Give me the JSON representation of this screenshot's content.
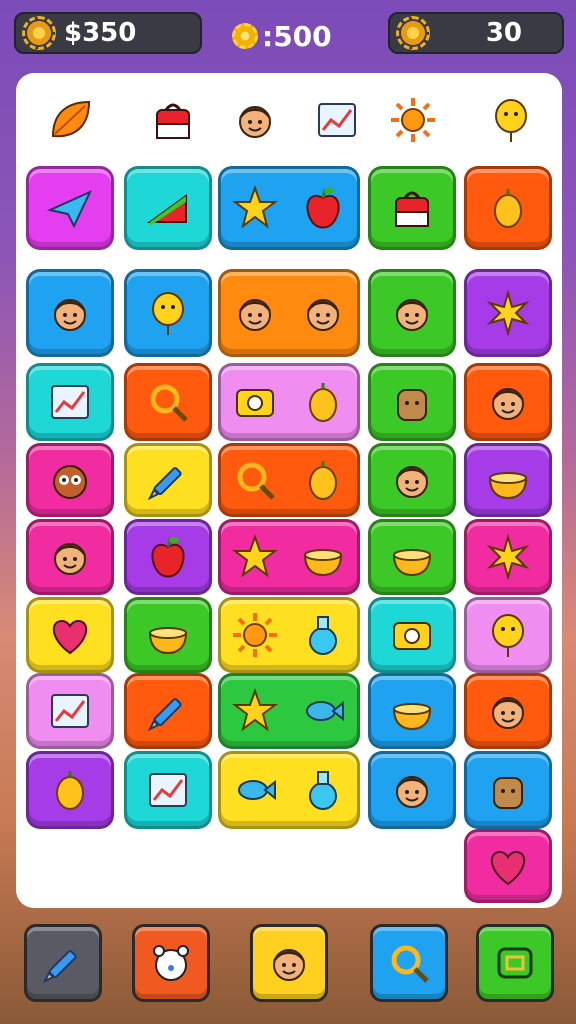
{
  "hud": {
    "money": "$350",
    "score": ":500",
    "timer": "30"
  },
  "header_icons": [
    "leaf-icon",
    "shopping-bag-icon",
    "character-face-icon",
    "picture-frame-icon",
    "sun-icon",
    "balloon-icon"
  ],
  "tiles": [
    {
      "icons": [
        "paper-plane-icon"
      ],
      "color": "#e53ef0"
    },
    {
      "icons": [
        "red-wedge-icon"
      ],
      "color": "#1ed8d8"
    },
    {
      "icons": [
        "star-icon",
        "apple-icon"
      ],
      "color": "#1fa2ef"
    },
    {
      "icons": [
        "backpack-icon"
      ],
      "color": "#3cc826"
    },
    {
      "icons": [
        "lemon-icon"
      ],
      "color": "#ff5a0d"
    },
    {
      "icons": [
        "elf-character-icon"
      ],
      "color": "#1fa2ef"
    },
    {
      "icons": [
        "balloon-icon"
      ],
      "color": "#1fa2ef"
    },
    {
      "icons": [
        "boy-face-icon",
        "girl-face-icon"
      ],
      "color": "#ff8a10"
    },
    {
      "icons": [
        "woman-face-icon"
      ],
      "color": "#3cc826"
    },
    {
      "icons": [
        "sparkle-stars-icon"
      ],
      "color": "#a63ce8"
    },
    {
      "icons": [
        "chart-icon"
      ],
      "color": "#1ed8d8"
    },
    {
      "icons": [
        "gem-icon"
      ],
      "color": "#ff5a0d"
    },
    {
      "icons": [
        "camera-icon",
        "mango-icon"
      ],
      "color": "#ef8ef0"
    },
    {
      "icons": [
        "toast-character-icon"
      ],
      "color": "#3cc826"
    },
    {
      "icons": [
        "smiling-man-icon"
      ],
      "color": "#ff5a0d"
    },
    {
      "icons": [
        "owl-icon"
      ],
      "color": "#f02ca0"
    },
    {
      "icons": [
        "pencil-icon"
      ],
      "color": "#ffe020"
    },
    {
      "icons": [
        "ring-icon",
        "lemon-icon"
      ],
      "color": "#ff5a0d"
    },
    {
      "icons": [
        "boy-face-icon"
      ],
      "color": "#3cc826"
    },
    {
      "icons": [
        "bowl-icon"
      ],
      "color": "#a63ce8"
    },
    {
      "icons": [
        "smiley-face-icon"
      ],
      "color": "#f02ca0"
    },
    {
      "icons": [
        "strawberry-icon"
      ],
      "color": "#a63ce8"
    },
    {
      "icons": [
        "star-icon",
        "bowl-icon"
      ],
      "color": "#f02ca0"
    },
    {
      "icons": [
        "honey-pot-icon"
      ],
      "color": "#3cc826"
    },
    {
      "icons": [
        "sun-star-icon"
      ],
      "color": "#f02ca0"
    },
    {
      "icons": [
        "heart-icon"
      ],
      "color": "#ffe020"
    },
    {
      "icons": [
        "pudding-icon"
      ],
      "color": "#3cc826"
    },
    {
      "icons": [
        "sun-icon",
        "potion-icon"
      ],
      "color": "#ffe020"
    },
    {
      "icons": [
        "console-icon"
      ],
      "color": "#1ed8d8"
    },
    {
      "icons": [
        "balloon-icon"
      ],
      "color": "#ef8ef0"
    },
    {
      "icons": [
        "frame-icon"
      ],
      "color": "#ef8ef0"
    },
    {
      "icons": [
        "pencil-icon"
      ],
      "color": "#ff5a0d"
    },
    {
      "icons": [
        "star-icon",
        "fish-icon"
      ],
      "color": "#2bc840"
    },
    {
      "icons": [
        "pot-icon"
      ],
      "color": "#1fa2ef"
    },
    {
      "icons": [
        "smiling-man-icon"
      ],
      "color": "#ff5a0d"
    },
    {
      "icons": [
        "mango-icon"
      ],
      "color": "#a63ce8"
    },
    {
      "icons": [
        "chart-icon"
      ],
      "color": "#1ed8d8"
    },
    {
      "icons": [
        "fish-icon",
        "potion-icon"
      ],
      "color": "#ffe020"
    },
    {
      "icons": [
        "smiling-man-icon"
      ],
      "color": "#1fa2ef"
    },
    {
      "icons": [
        "plant-pot-icon"
      ],
      "color": "#1fa2ef"
    },
    {
      "icons": [
        "heart-icon"
      ],
      "color": "#f02ca0"
    }
  ],
  "toolbar": [
    {
      "icon": "pencil-icon",
      "color": "#5a5a64"
    },
    {
      "icon": "bear-icon",
      "color": "#f05a20"
    },
    {
      "icon": "face-icon",
      "color": "#ffd020"
    },
    {
      "icon": "magnifier-icon",
      "color": "#1fa2ef"
    },
    {
      "icon": "puzzle-icon",
      "color": "#3cc826"
    }
  ]
}
